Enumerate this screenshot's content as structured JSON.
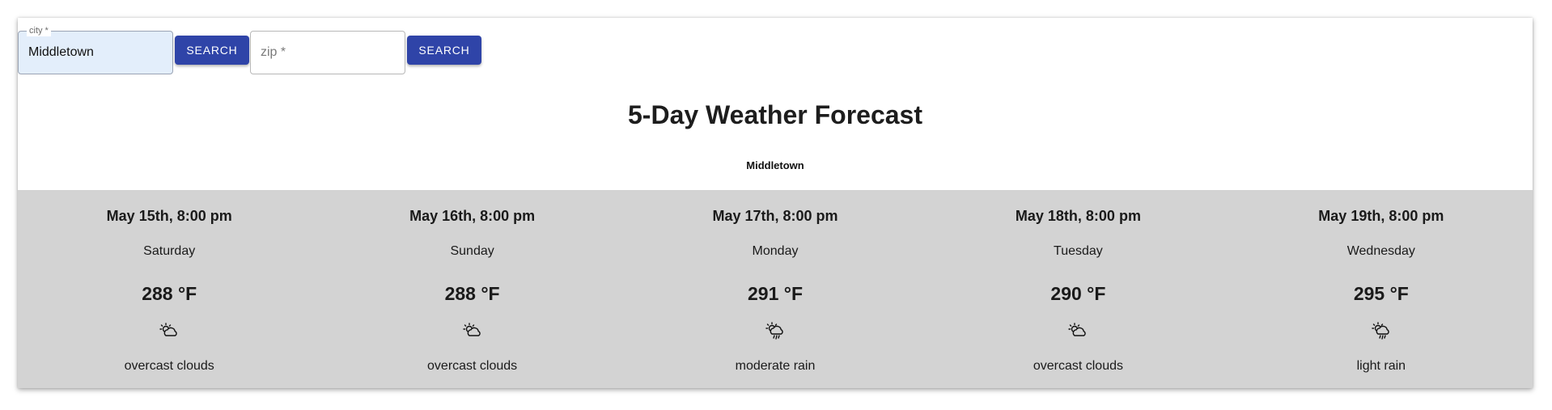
{
  "search": {
    "city_label": "city *",
    "city_value": "Middletown",
    "city_button": "SEARCH",
    "zip_placeholder": "zip *",
    "zip_value": "",
    "zip_button": "SEARCH"
  },
  "header": {
    "title": "5-Day Weather Forecast",
    "location": "Middletown"
  },
  "forecast": [
    {
      "date": "May 15th, 8:00 pm",
      "day": "Saturday",
      "temp": "288 °F",
      "icon": "cloudy-sun-icon",
      "description": "overcast clouds"
    },
    {
      "date": "May 16th, 8:00 pm",
      "day": "Sunday",
      "temp": "288 °F",
      "icon": "cloudy-sun-icon",
      "description": "overcast clouds"
    },
    {
      "date": "May 17th, 8:00 pm",
      "day": "Monday",
      "temp": "291 °F",
      "icon": "rain-sun-icon",
      "description": "moderate rain"
    },
    {
      "date": "May 18th, 8:00 pm",
      "day": "Tuesday",
      "temp": "290 °F",
      "icon": "cloudy-sun-icon",
      "description": "overcast clouds"
    },
    {
      "date": "May 19th, 8:00 pm",
      "day": "Wednesday",
      "temp": "295 °F",
      "icon": "rain-sun-icon",
      "description": "light rain"
    }
  ],
  "colors": {
    "button": "#2f44a8",
    "forecast_bg": "#d3d3d3",
    "city_field_bg": "#e3eefb"
  }
}
